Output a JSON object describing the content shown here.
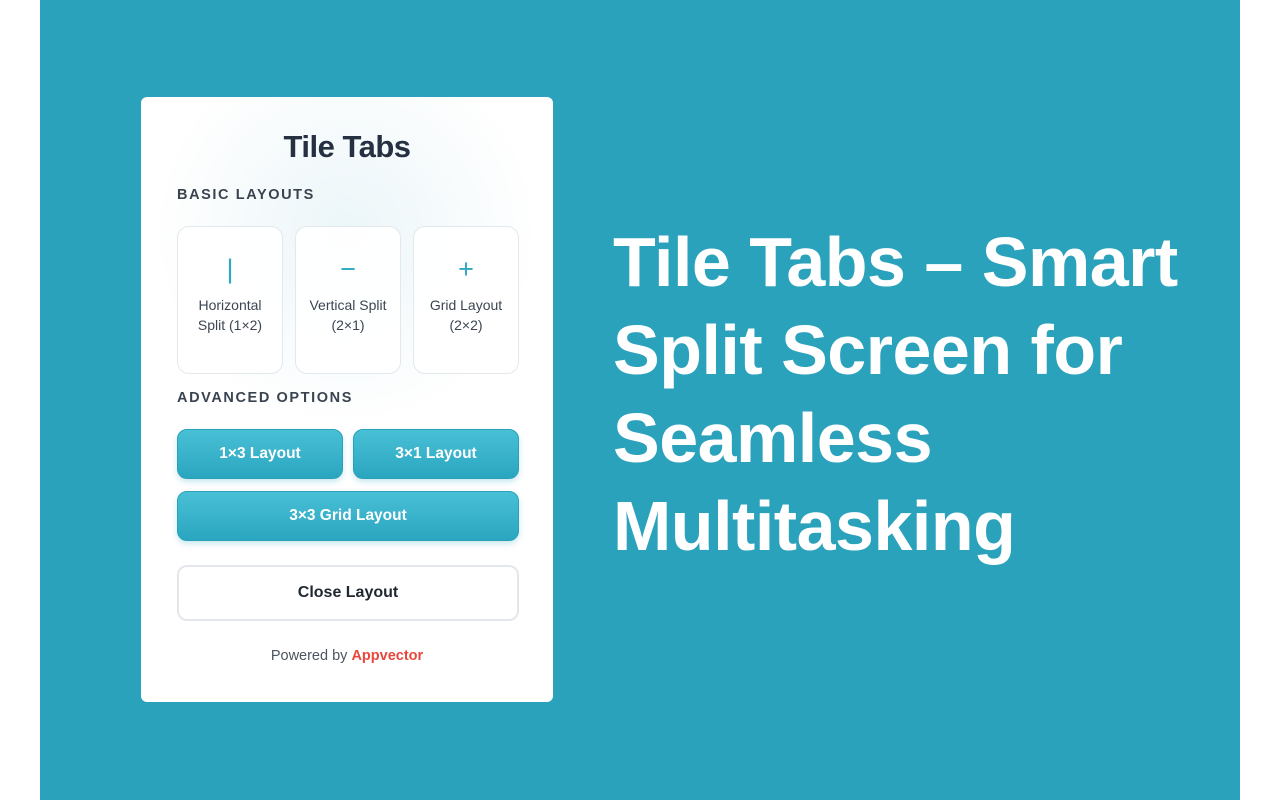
{
  "popup": {
    "title": "Tile Tabs",
    "basic_section": "BASIC LAYOUTS",
    "basic_layouts": [
      {
        "icon": "vertical-bar-icon",
        "glyph": "|",
        "label": "Horizontal Split (1×2)"
      },
      {
        "icon": "minus-icon",
        "glyph": "−",
        "label": "Vertical Split (2×1)"
      },
      {
        "icon": "plus-icon",
        "glyph": "+",
        "label": "Grid Layout (2×2)"
      }
    ],
    "advanced_section": "ADVANCED OPTIONS",
    "advanced_buttons": [
      "1×3 Layout",
      "3×1 Layout",
      "3×3 Grid Layout"
    ],
    "close_label": "Close Layout",
    "footer_prefix": "Powered by",
    "footer_brand": "Appvector"
  },
  "headline": "Tile Tabs – Smart Split Screen for Seamless Multitasking",
  "colors": {
    "background": "#2ba2bb",
    "accent": "#2ea8c3",
    "brand": "#e8473c",
    "title_text": "#253040"
  }
}
